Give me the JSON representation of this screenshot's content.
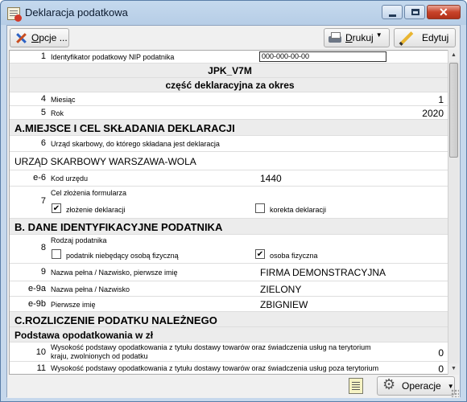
{
  "window": {
    "title": "Deklaracja podatkowa"
  },
  "toolbar": {
    "options_label_u": "O",
    "options_label_rest": "pcje ...",
    "print_label_u": "D",
    "print_label_rest": "rukuj",
    "edit_label": "Edytuj"
  },
  "rows": {
    "r1": {
      "num": "1",
      "label": "Identyfikator podatkowy NIP podatnika",
      "value": "000-000-00-00"
    },
    "form_code": "JPK_V7M",
    "form_sub": "część deklaracyjna za okres",
    "r4": {
      "num": "4",
      "label": "Miesiąc",
      "value": "1"
    },
    "r5": {
      "num": "5",
      "label": "Rok",
      "value": "2020"
    },
    "secA": "A.MIEJSCE I CEL SKŁADANIA DEKLARACJI",
    "r6": {
      "num": "6",
      "label": "Urząd skarbowy, do którego składana jest deklaracja"
    },
    "office_name": "URZĄD SKARBOWY WARSZAWA-WOLA",
    "re6": {
      "num": "e-6",
      "label": "Kod urzędu",
      "value": "1440"
    },
    "r7": {
      "num": "7",
      "label": "Cel złożenia formularza",
      "opt1": "złożenie deklaracji",
      "opt2": "korekta deklaracji"
    },
    "secB": "B. DANE IDENTYFIKACYJNE PODATNIKA",
    "r8": {
      "num": "8",
      "label": "Rodzaj podatnika",
      "opt1": "podatnik niebędący osobą fizyczną",
      "opt2": "osoba fizyczna"
    },
    "r9": {
      "num": "9",
      "label": "Nazwa pełna / Nazwisko, pierwsze imię",
      "value": "FIRMA DEMONSTRACYJNA"
    },
    "re9a": {
      "num": "e-9a",
      "label": "Nazwa pełna / Nazwisko",
      "value": "ZIELONY"
    },
    "re9b": {
      "num": "e-9b",
      "label": "Pierwsze imię",
      "value": "ZBIGNIEW"
    },
    "secC": "C.ROZLICZENIE PODATKU NALEŻNEGO",
    "subC": "Podstawa opodatkowania w zł",
    "r10": {
      "num": "10",
      "label_line1": "Wysokość podstawy opodatkowania z tytułu dostawy towarów oraz świadczenia usług na terytorium",
      "label_line2": "kraju, zwolnionych od podatku",
      "value": "0"
    },
    "r11": {
      "num": "11",
      "label": "Wysokość podstawy opodatkowania z tytułu dostawy towarów oraz świadczenia usług poza terytorium",
      "value": "0"
    }
  },
  "bottom": {
    "operations_label": "Operacje"
  },
  "state": {
    "r7_opt1_checked": true,
    "r7_opt2_checked": false,
    "r8_opt1_checked": false,
    "r8_opt2_checked": true
  }
}
